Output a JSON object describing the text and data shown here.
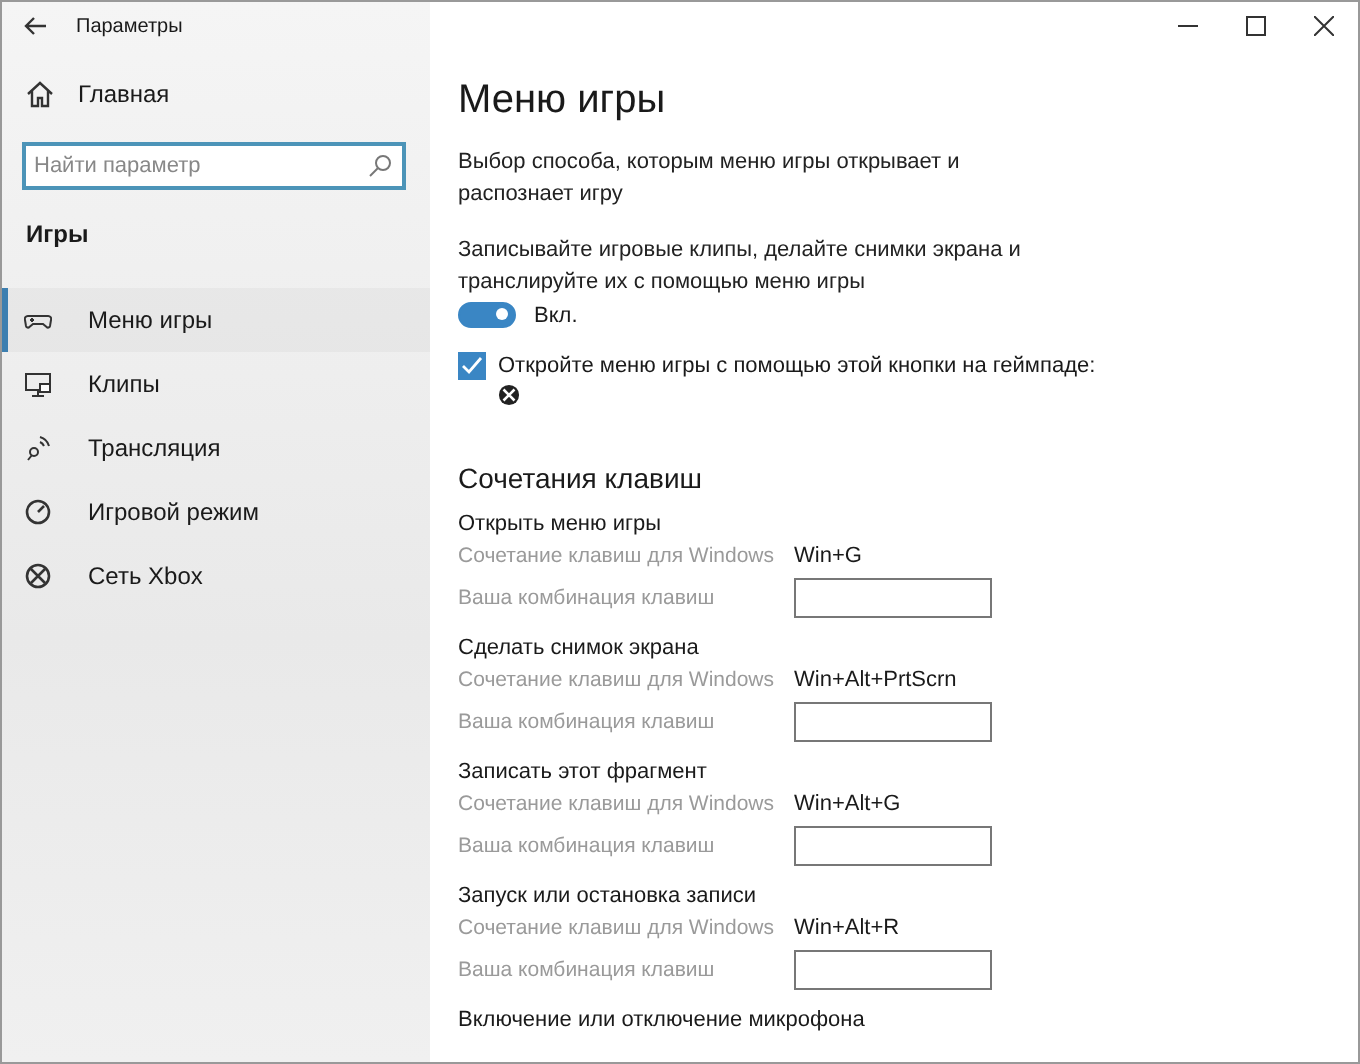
{
  "window": {
    "title": "Параметры"
  },
  "sidebar": {
    "home": "Главная",
    "search": {
      "placeholder": "Найти параметр"
    },
    "section": "Игры",
    "items": [
      {
        "label": "Меню игры",
        "selected": true
      },
      {
        "label": "Клипы",
        "selected": false
      },
      {
        "label": "Трансляция",
        "selected": false
      },
      {
        "label": "Игровой режим",
        "selected": false
      },
      {
        "label": "Сеть Xbox",
        "selected": false
      }
    ]
  },
  "main": {
    "title": "Меню игры",
    "description": "Выбор способа, которым меню игры открывает и распознает игру",
    "capture_text": "Записывайте игровые клипы, делайте снимки экрана и транслируйте их с помощью меню игры",
    "toggle": {
      "on": true,
      "label": "Вкл."
    },
    "checkbox": {
      "checked": true,
      "label": "Откройте меню игры с помощью этой кнопки на геймпаде:"
    },
    "shortcuts_heading": "Сочетания клавиш",
    "shortcuts": [
      {
        "title": "Открыть меню игры",
        "windows_label": "Сочетание клавиш для Windows",
        "windows_keys": "Win+G",
        "custom_label": "Ваша комбинация клавиш"
      },
      {
        "title": "Сделать снимок экрана",
        "windows_label": "Сочетание клавиш для Windows",
        "windows_keys": "Win+Alt+PrtScrn",
        "custom_label": "Ваша комбинация клавиш"
      },
      {
        "title": "Записать этот фрагмент",
        "windows_label": "Сочетание клавиш для Windows",
        "windows_keys": "Win+Alt+G",
        "custom_label": "Ваша комбинация клавиш"
      },
      {
        "title": "Запуск или остановка записи",
        "windows_label": "Сочетание клавиш для Windows",
        "windows_keys": "Win+Alt+R",
        "custom_label": "Ваша комбинация клавиш"
      },
      {
        "title": "Включение или отключение микрофона"
      }
    ]
  }
}
